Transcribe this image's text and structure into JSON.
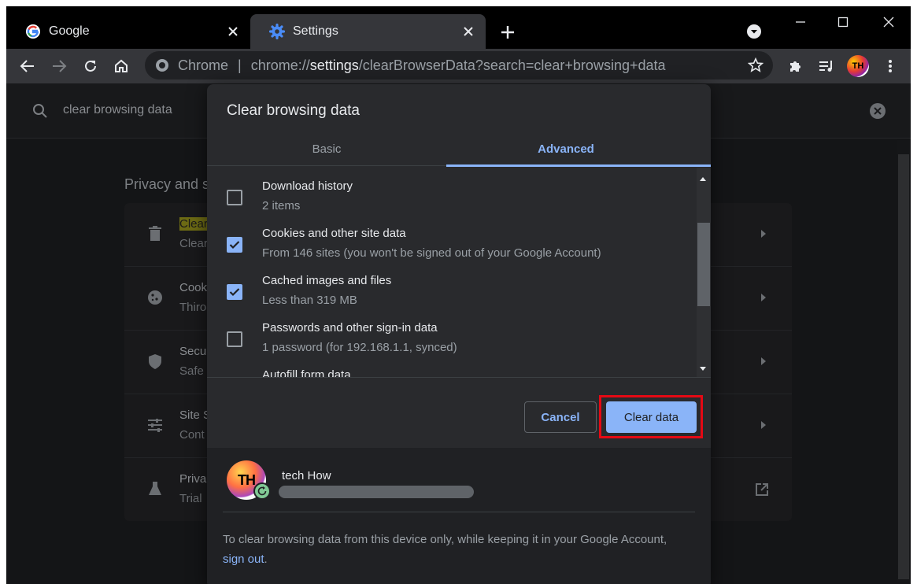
{
  "tabs": [
    {
      "title": "Google",
      "icon": "google-icon"
    },
    {
      "title": "Settings",
      "icon": "gear-icon"
    }
  ],
  "toolbar": {
    "omnibox": {
      "prefix": "Chrome",
      "separator": "|",
      "url_scheme": "chrome://",
      "url_host": "settings",
      "url_path": "/clearBrowserData?search=clear+browsing+data"
    },
    "profile_initials": "TH"
  },
  "settings_page": {
    "search_query": "clear browsing data",
    "section_title": "Privacy and s",
    "rows": [
      {
        "title_highlight": "Clear",
        "title_rest": "",
        "subtitle": "Clear",
        "icon": "trash-icon"
      },
      {
        "title_highlight": "",
        "title_rest": "Cook",
        "subtitle": "Thiro",
        "icon": "cookie-icon"
      },
      {
        "title_highlight": "",
        "title_rest": "Secu",
        "subtitle": "Safe",
        "icon": "shield-icon"
      },
      {
        "title_highlight": "",
        "title_rest": "Site S",
        "subtitle": "Cont",
        "icon": "tune-icon"
      },
      {
        "title_highlight": "",
        "title_rest": "Priva",
        "subtitle": "Trial",
        "icon": "flask-icon"
      }
    ]
  },
  "dialog": {
    "title": "Clear browsing data",
    "tab_basic": "Basic",
    "tab_advanced": "Advanced",
    "items": [
      {
        "title": "Download history",
        "subtitle": "2 items",
        "checked": false
      },
      {
        "title": "Cookies and other site data",
        "subtitle": "From 146 sites (you won't be signed out of your Google Account)",
        "checked": true
      },
      {
        "title": "Cached images and files",
        "subtitle": "Less than 319 MB",
        "checked": true
      },
      {
        "title": "Passwords and other sign-in data",
        "subtitle": "1 password (for 192.168.1.1, synced)",
        "checked": false
      },
      {
        "title": "Autofill form data",
        "subtitle": "",
        "checked": false
      }
    ],
    "cancel_label": "Cancel",
    "clear_label": "Clear data",
    "account_name": "tech How",
    "avatar_initials": "TH",
    "footer_text": "To clear browsing data from this device only, while keeping it in your Google Account,",
    "footer_link": "sign out",
    "footer_end": "."
  },
  "colors": {
    "accent": "#8ab4f8",
    "highlight_box": "#e50914",
    "dialog_bg": "#292a2d"
  }
}
